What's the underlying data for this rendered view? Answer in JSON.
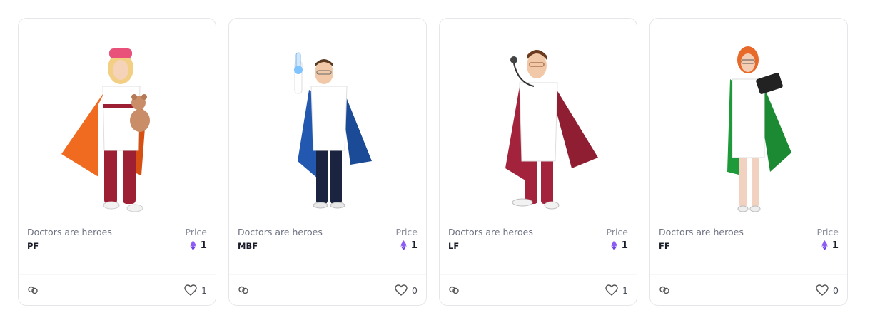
{
  "cards": [
    {
      "collection": "Doctors are heroes",
      "price_label": "Price",
      "name": "PF",
      "price": "1",
      "currency_icon": "ethereum-icon",
      "likes": "1",
      "image": {
        "hair": "#f2cf84",
        "cap": "#e9507a",
        "cape": "#f06a1f",
        "pants": "#9c1f33",
        "coat": "#ffffff",
        "accessory": "teddy-bear"
      }
    },
    {
      "collection": "Doctors are heroes",
      "price_label": "Price",
      "name": "MBF",
      "price": "1",
      "currency_icon": "ethereum-icon",
      "likes": "0",
      "image": {
        "hair": "#5a3b22",
        "cape": "#2358b0",
        "pants": "#1a2440",
        "coat": "#ffffff",
        "accessory": "test-tube"
      }
    },
    {
      "collection": "Doctors are heroes",
      "price_label": "Price",
      "name": "LF",
      "price": "1",
      "currency_icon": "ethereum-icon",
      "likes": "1",
      "image": {
        "hair": "#6b3a1e",
        "cape": "#a3233c",
        "pants": "#a3233c",
        "coat": "#ffffff",
        "accessory": "stethoscope"
      }
    },
    {
      "collection": "Doctors are heroes",
      "price_label": "Price",
      "name": "FF",
      "price": "1",
      "currency_icon": "ethereum-icon",
      "likes": "0",
      "image": {
        "hair": "#e86a2b",
        "cape": "#1f9a3a",
        "pants": "#f1d2c0",
        "coat": "#ffffff",
        "accessory": "tablet"
      }
    }
  ]
}
